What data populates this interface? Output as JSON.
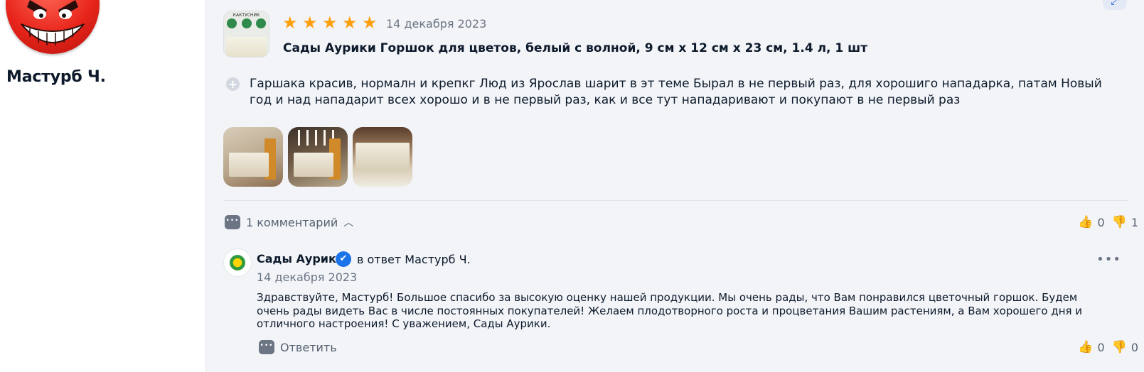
{
  "author": {
    "name": "Мастурб Ч."
  },
  "review": {
    "rating": 5,
    "date": "14 декабря 2023",
    "product_title": "Сады Аурики Горшок для цветов, белый с волной, 9 см x 12 см x 23 см, 1.4 л, 1 шт",
    "product_thumb_brand": "КАКТУСНИК",
    "text": "Гаршака красив, нормалн и крепкг Люд из Ярослав шарит в эт теме Бырал в не первый раз, для хорошиго нападарка, патам Новый год и над нападарит всех хорошо и в не первый раз, как и все тут нападаривают и покупают в не первый раз",
    "photos_count": 3,
    "comments_label": "1 комментарий",
    "likes": "0",
    "dislikes": "1"
  },
  "reply": {
    "author": "Сады Аурики",
    "in_reply_to": "в ответ Мастурб Ч.",
    "date": "14 декабря 2023",
    "text": "Здравствуйте, Мастурб! Большое спасибо за высокую оценку нашей продукции. Мы очень рады, что Вам понравился цветочный горшок. Будем очень рады видеть Вас в числе постоянных покупателей! Желаем плодотворного роста и процветания Вашим растениям, а Вам хорошего дня и отличного настроения! С уважением, Сады Аурики.",
    "answer_label": "Ответить",
    "likes": "0",
    "dislikes": "0"
  },
  "colors": {
    "star": "#ff9f0e",
    "verified": "#1a73e8",
    "card_bg": "#f2f4f8"
  }
}
